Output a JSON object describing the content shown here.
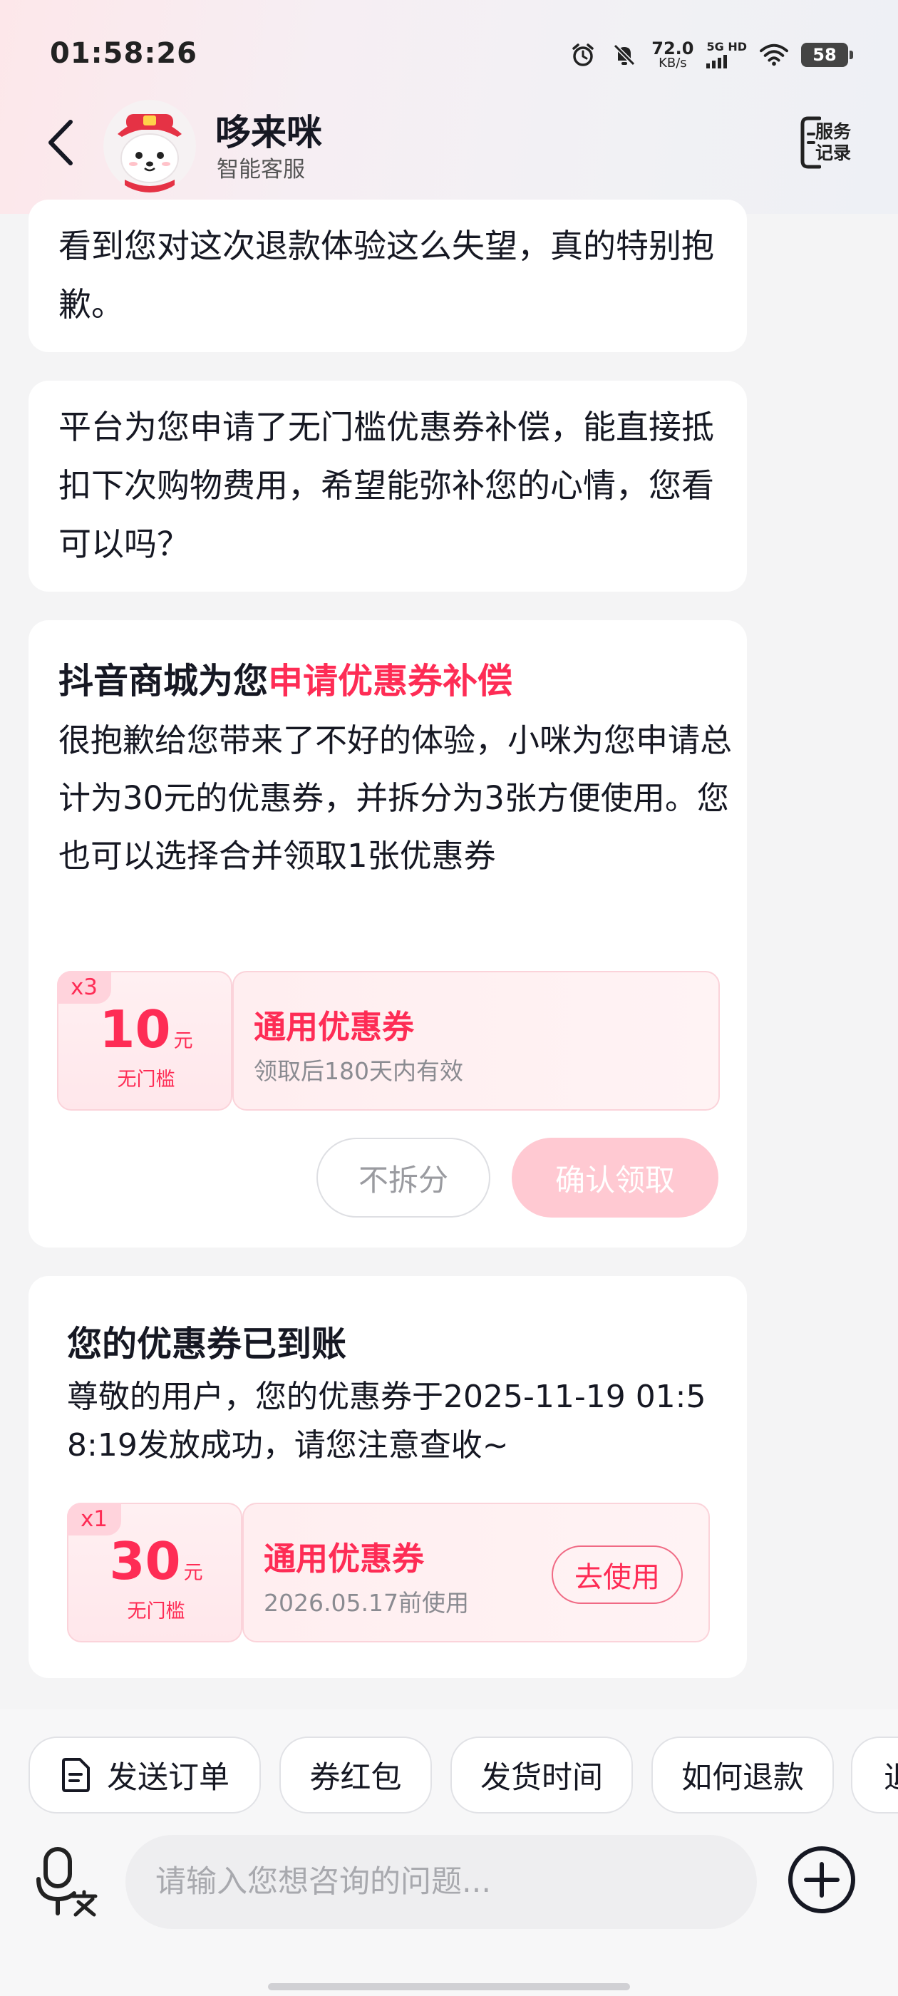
{
  "status_bar": {
    "time": "01:58:26",
    "net_speed_value": "72.0",
    "net_speed_unit": "KB/s",
    "network": "5G HD",
    "battery": "58"
  },
  "header": {
    "agent_name": "哆来咪",
    "agent_role": "智能客服",
    "service_record_label": "服务记录"
  },
  "messages": [
    {
      "text": "看到您对这次退款体验这么失望，真的特别抱歉。"
    },
    {
      "text": "平台为您申请了无门槛优惠券补偿，能直接抵扣下次购物费用，希望能弥补您的心情，您看可以吗？"
    }
  ],
  "compensation_card": {
    "title_prefix": "抖音商城为您",
    "title_highlight": "申请优惠券补偿",
    "body": "很抱歉给您带来了不好的体验，小咪为您申请总计为30元的优惠券，并拆分为3张方便使用。您也可以选择合并领取1张优惠券",
    "coupon": {
      "qty": "x3",
      "amount": "10",
      "unit": "元",
      "threshold": "无门槛",
      "name": "通用优惠券",
      "desc": "领取后180天内有效"
    },
    "no_split_label": "不拆分",
    "confirm_label": "确认领取"
  },
  "arrival_card": {
    "title": "您的优惠券已到账",
    "body": "尊敬的用户，您的优惠券于2025-11-19 01:58:19发放成功，请您注意查收~",
    "coupon": {
      "qty": "x1",
      "amount": "30",
      "unit": "元",
      "threshold": "无门槛",
      "name": "通用优惠券",
      "desc": "2026.05.17前使用",
      "use_label": "去使用"
    }
  },
  "quick_actions": [
    "发送订单",
    "券红包",
    "发货时间",
    "如何退款",
    "退"
  ],
  "input": {
    "placeholder": "请输入您想咨询的问题..."
  },
  "colors": {
    "accent": "#fe2c55",
    "confirm_disabled": "#ffc9d2",
    "background": "#f4f4f5"
  }
}
